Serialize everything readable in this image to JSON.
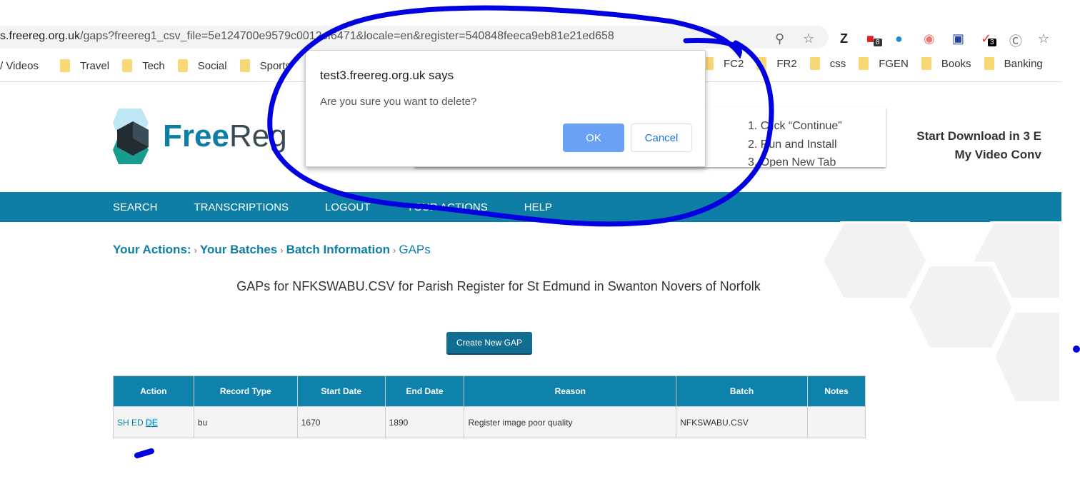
{
  "browser": {
    "url_host": "s.freereg.org.uk",
    "url_path": "/gaps?freereg1_csv_file=5e124700e9579c0012cf6471&locale=en&register=540848feeca9eb81e21ed658",
    "extension_badges": [
      "8",
      "3"
    ],
    "bookmarks": [
      "/ Videos",
      "Travel",
      "Tech",
      "Social",
      "Sports",
      "",
      "",
      "",
      "",
      "",
      "FC2",
      "FR2",
      "css",
      "FGEN",
      "Books",
      "Banking"
    ]
  },
  "site": {
    "logo_free": "Free",
    "logo_reg": "Reg",
    "nav": [
      "SEARCH",
      "TRANSCRIPTIONS",
      "LOGOUT",
      "YOUR ACTIONS",
      "HELP"
    ],
    "breadcrumb": [
      "Your Actions:",
      "Your Batches",
      "Batch Information",
      "GAPs"
    ],
    "title": "GAPs for NFKSWABU.CSV for Parish Register for St Edmund in Swanton Novers of Norfolk",
    "create_button": "Create New GAP",
    "table": {
      "headers": [
        "Action",
        "Record Type",
        "Start Date",
        "End Date",
        "Reason",
        "Batch",
        "Notes"
      ],
      "rows": [
        {
          "actions": [
            "SH",
            "ED",
            "DE"
          ],
          "record_type": "bu",
          "start": "1670",
          "end": "1890",
          "reason": "Register image poor quality",
          "batch": "NFKSWABU.CSV",
          "notes": ""
        }
      ]
    }
  },
  "ad": {
    "steps": [
      "1. Click “Continue”",
      "2. Run and Install",
      "3. Open New Tab"
    ],
    "headline1": "Start Download in 3 E",
    "headline2": "My Video Conv"
  },
  "dialog": {
    "title": "test3.freereg.org.uk says",
    "message": "Are you sure you want to delete?",
    "ok": "OK",
    "cancel": "Cancel"
  },
  "colors": {
    "brand": "#0f7ea6",
    "table_header": "#0e82ab",
    "annotation": "#0000e0"
  }
}
